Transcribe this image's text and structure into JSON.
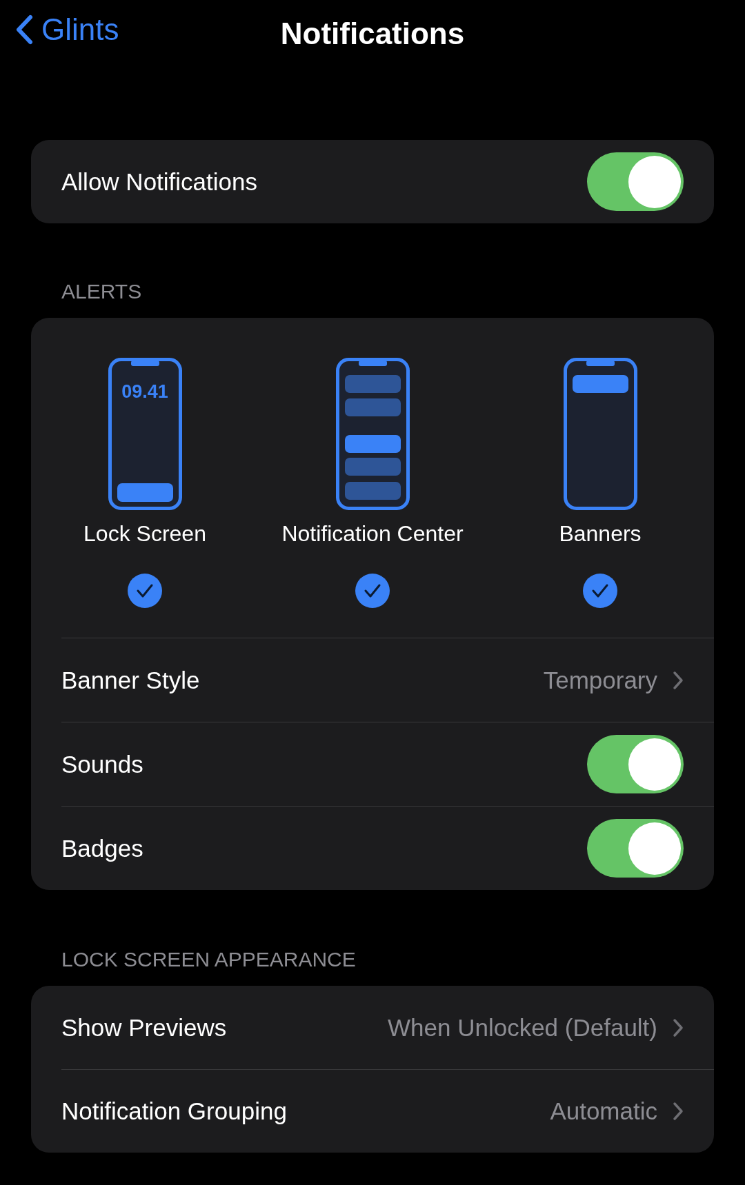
{
  "nav": {
    "back_label": "Glints",
    "title": "Notifications"
  },
  "allow": {
    "label": "Allow Notifications",
    "on": true
  },
  "alerts": {
    "header": "ALERTS",
    "styles": [
      {
        "kind": "lock",
        "label": "Lock Screen",
        "time": "09.41",
        "checked": true
      },
      {
        "kind": "center",
        "label": "Notification Center",
        "checked": true
      },
      {
        "kind": "banner",
        "label": "Banners",
        "checked": true
      }
    ],
    "rows": [
      {
        "kind": "value",
        "label": "Banner Style",
        "value": "Temporary"
      },
      {
        "kind": "toggle",
        "label": "Sounds",
        "on": true
      },
      {
        "kind": "toggle",
        "label": "Badges",
        "on": true
      }
    ]
  },
  "lock_screen": {
    "header": "LOCK SCREEN APPEARANCE",
    "rows": [
      {
        "kind": "value",
        "label": "Show Previews",
        "value": "When Unlocked (Default)"
      },
      {
        "kind": "value",
        "label": "Notification Grouping",
        "value": "Automatic"
      }
    ]
  }
}
